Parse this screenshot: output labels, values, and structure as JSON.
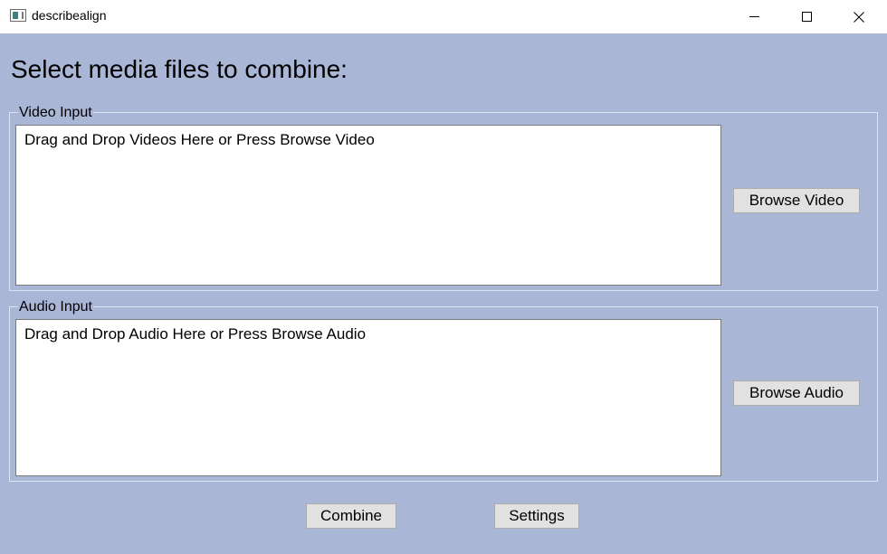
{
  "window": {
    "title": "describealign",
    "icons": {
      "app": "app-window-icon",
      "minimize": "minimize-icon",
      "maximize": "maximize-icon",
      "close": "close-icon"
    }
  },
  "main": {
    "heading": "Select media files to combine:",
    "video": {
      "group_label": "Video Input",
      "drop_text": "Drag and Drop Videos Here or Press Browse Video",
      "browse_label": "Browse Video"
    },
    "audio": {
      "group_label": "Audio Input",
      "drop_text": "Drag and Drop Audio Here or Press Browse Audio",
      "browse_label": "Browse Audio"
    },
    "combine_label": "Combine",
    "settings_label": "Settings"
  },
  "colors": {
    "background": "#aab6d5",
    "button": "#e1e1e1",
    "group_border": "#dde3f0"
  }
}
